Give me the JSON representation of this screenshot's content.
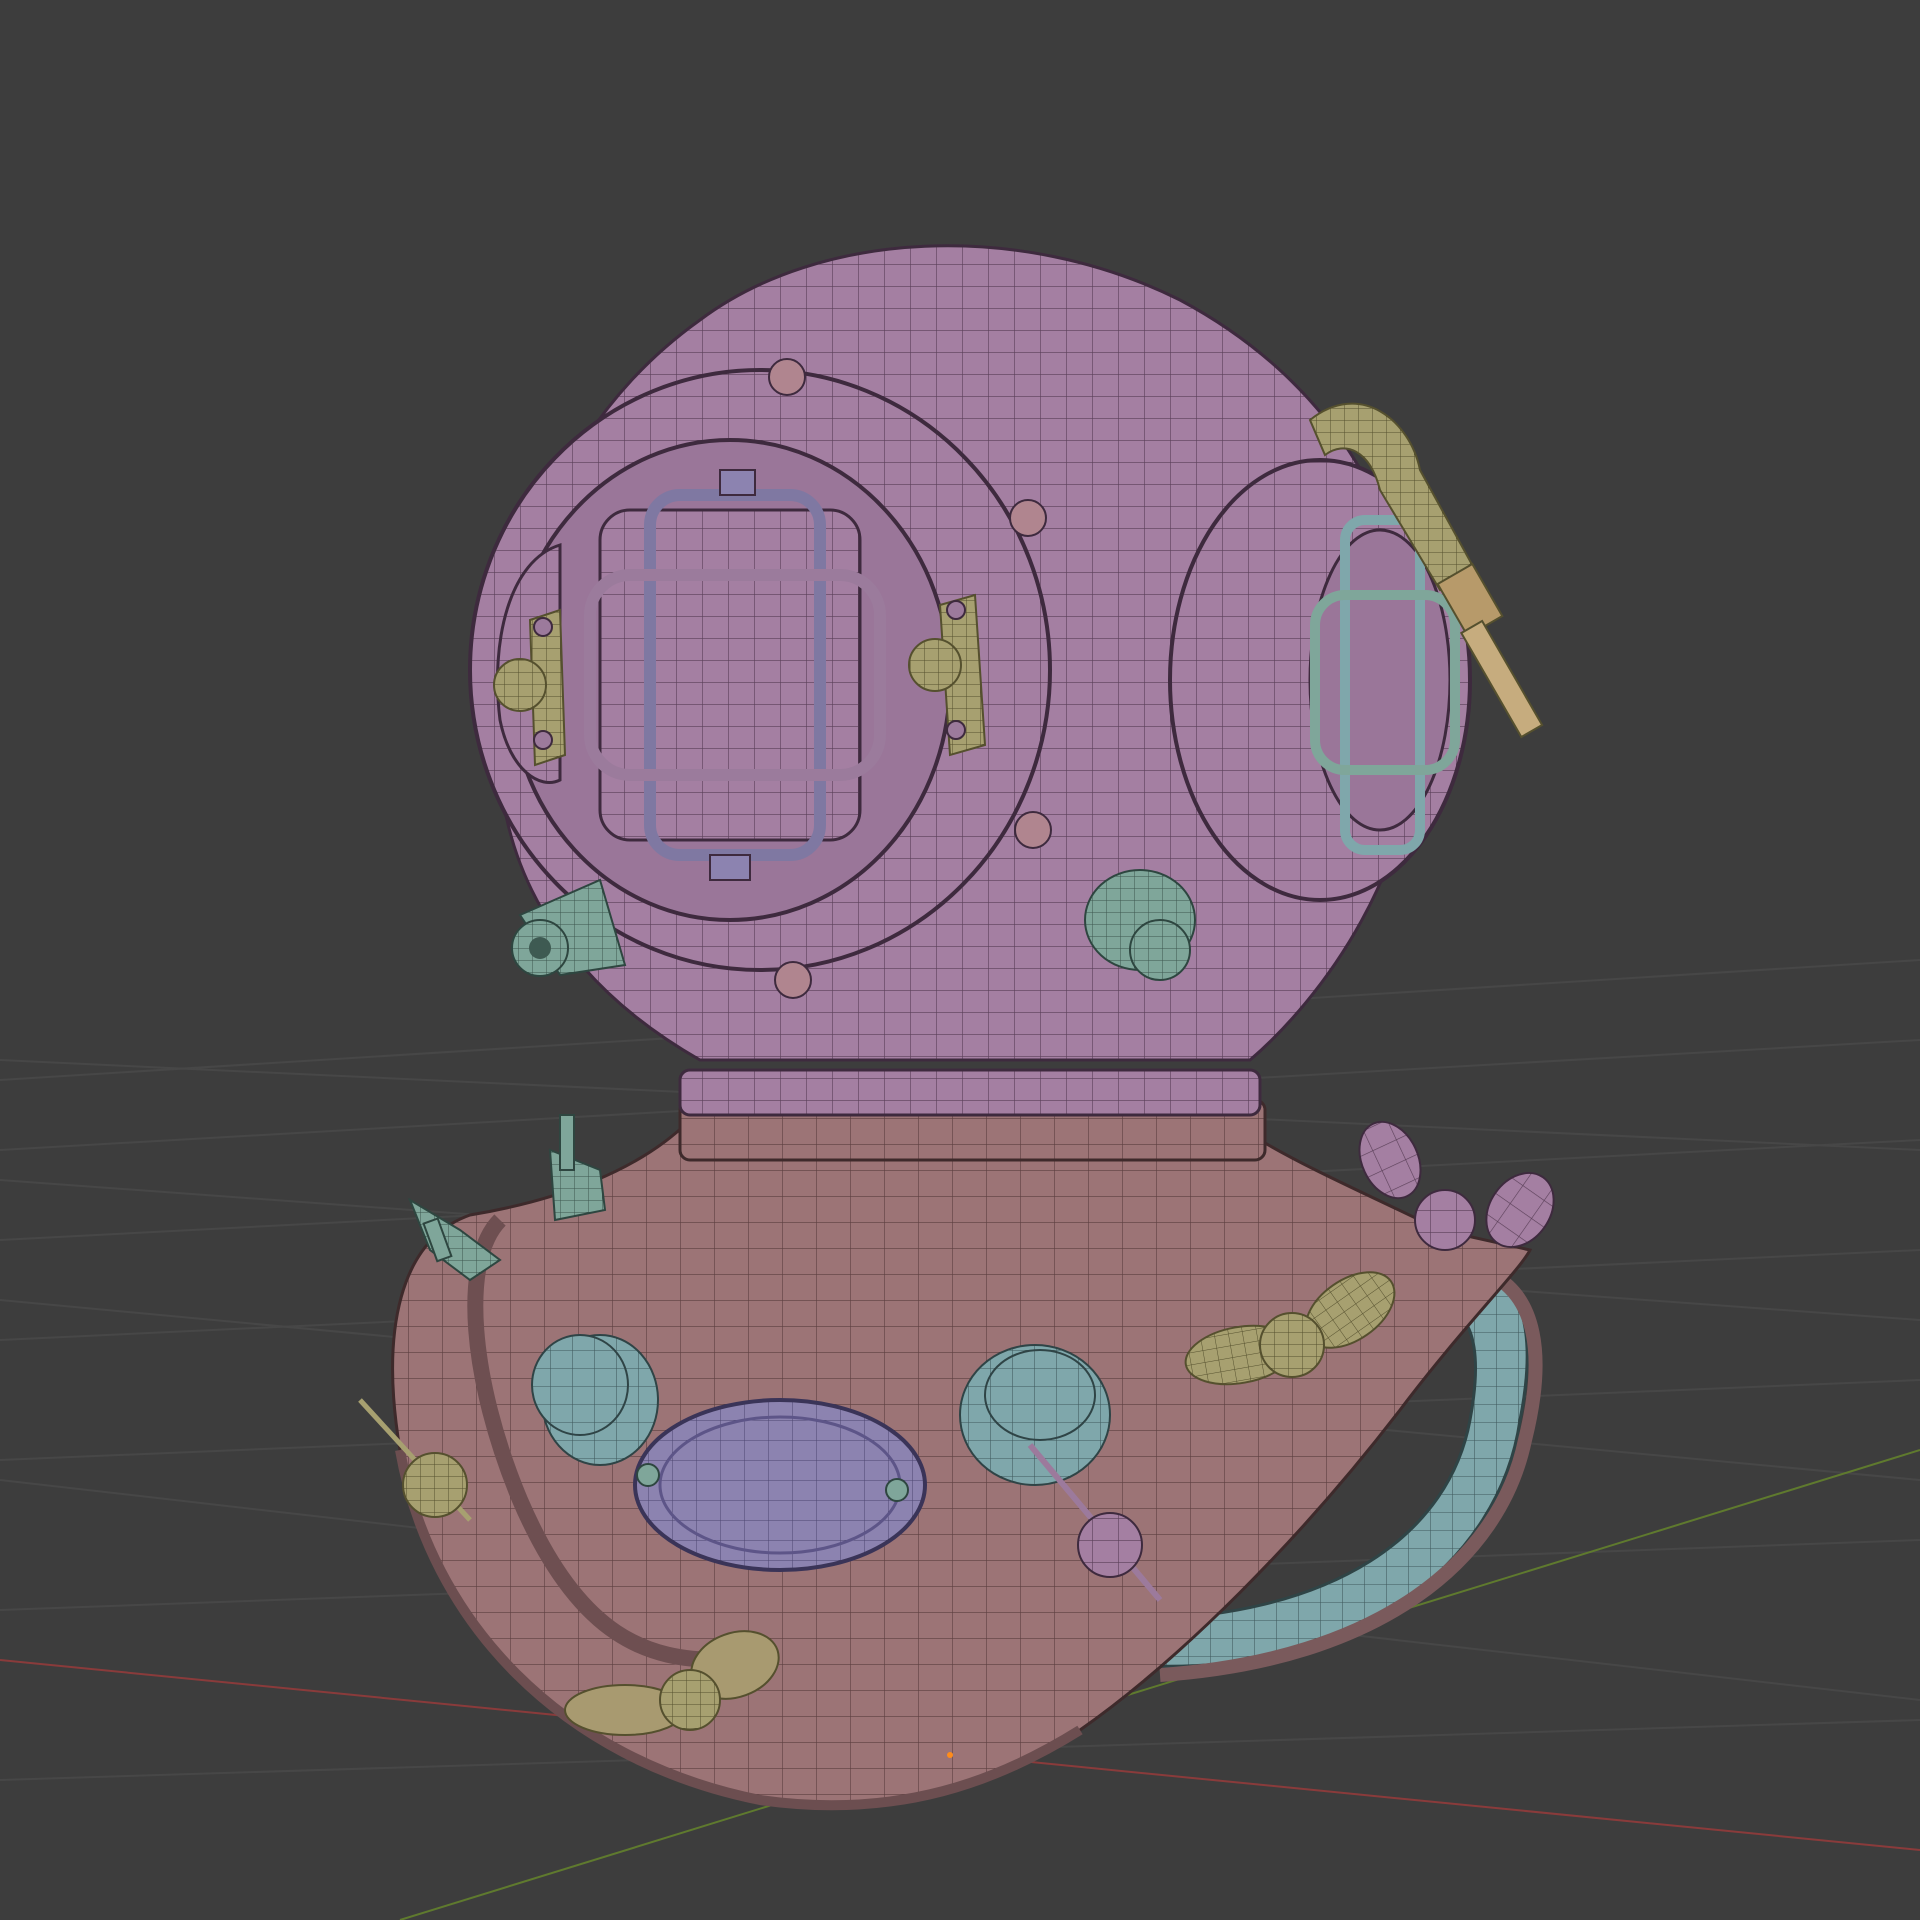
{
  "viewport": {
    "background": "#3d3d3d",
    "grid_color": "#4a4a4a",
    "axis_x_color": "#8a3b3b",
    "axis_y_color": "#5f7a2e",
    "origin_color": "#ff8c1a",
    "overlay": "wireframe"
  },
  "model": {
    "helmet_color": "#a47fa2",
    "breastplate_color": "#9c7476",
    "strap_color": "#7fa7ab",
    "knob_color": "#7fa69a",
    "wingnut_color": "#a7a070",
    "window_frame_color": "#7f78a2",
    "hose_color": "#b0ad74"
  }
}
